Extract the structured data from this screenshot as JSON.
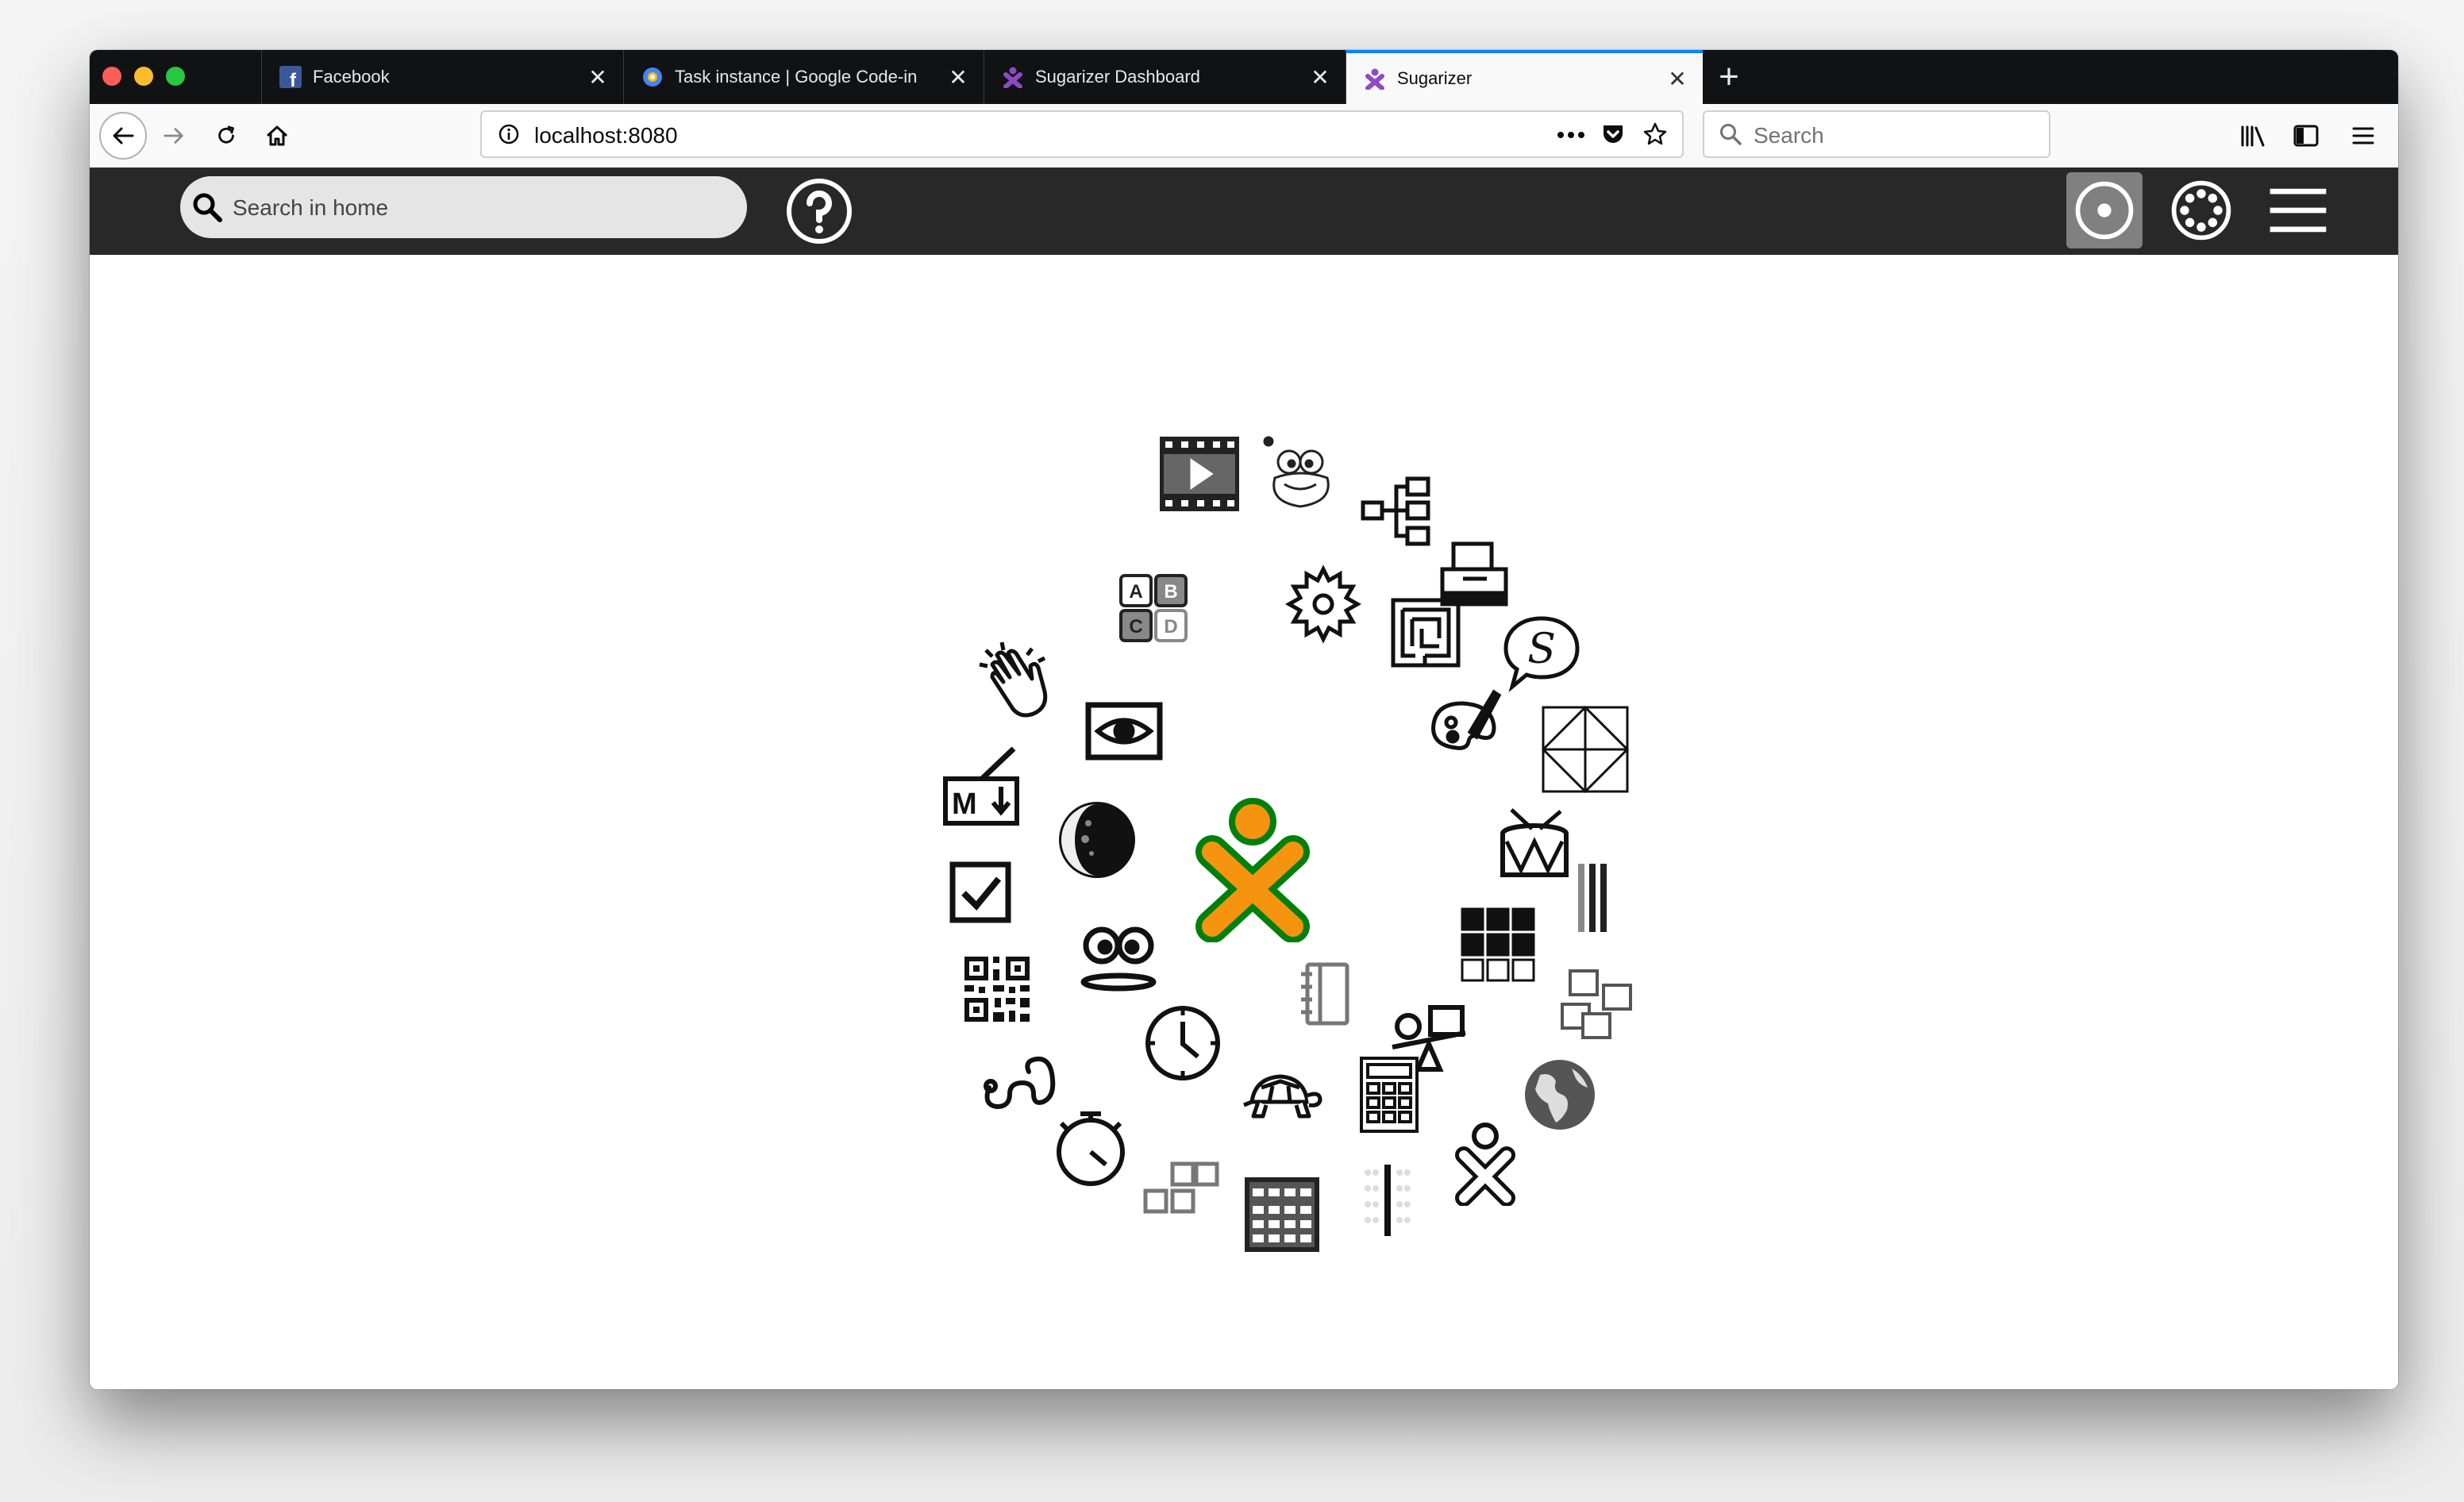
{
  "browser": {
    "tabs": [
      {
        "title": "Facebook",
        "favicon": "facebook-icon"
      },
      {
        "title": "Task instance | Google Code-in",
        "favicon": "google-codein-icon"
      },
      {
        "title": "Sugarizer Dashboard",
        "favicon": "sugarizer-icon"
      },
      {
        "title": "Sugarizer",
        "favicon": "sugarizer-icon",
        "active": true
      }
    ],
    "url": "localhost:8080",
    "search_placeholder": "Search"
  },
  "toolbar": {
    "search_placeholder": "Search in home"
  },
  "home": {
    "view": "radial",
    "activities": [
      "video-viewer-icon",
      "tamtam-frog-icon",
      "mindmap-icon",
      "print-icon",
      "speak-icon",
      "tangram-icon",
      "drum-icon",
      "bars-icon",
      "squares-icon",
      "globe-icon",
      "xo-icon",
      "abacus-icon",
      "grid-icon",
      "tuxmath-icon",
      "stopwatch-icon",
      "snake-icon",
      "qr-code-icon",
      "checkbox-icon",
      "markdown-icon",
      "clap-icon",
      "abcd-icon",
      "gear-icon",
      "maze-icon",
      "paint-icon",
      "color-grid-icon",
      "seesaw-icon",
      "calculator-icon",
      "turtle-icon",
      "clock-icon",
      "face-icon",
      "moon-icon",
      "eye-icon",
      "journal-icon"
    ]
  },
  "colors": {
    "xo_fill": "#f7940f",
    "xo_stroke": "#008009",
    "toolbar_bg": "#282828",
    "tab_accent": "#0a84ff"
  }
}
